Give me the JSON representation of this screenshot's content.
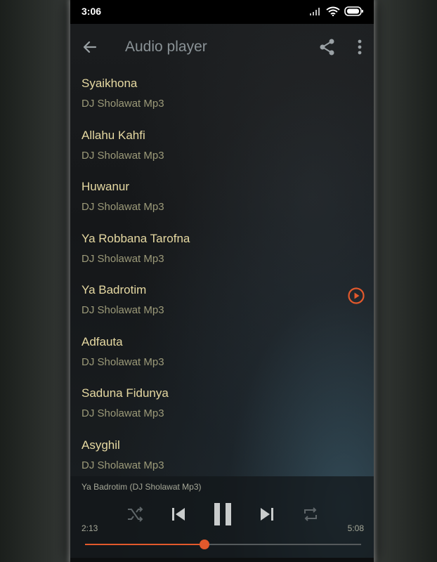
{
  "status_bar": {
    "time": "3:06",
    "icons": [
      "signal-icon",
      "wifi-icon",
      "battery-icon"
    ]
  },
  "app_bar": {
    "title": "Audio player",
    "icons": [
      "back-arrow-icon",
      "share-icon",
      "more-vert-icon"
    ]
  },
  "tracks": [
    {
      "title": "Syaikhona",
      "subtitle": "DJ Sholawat Mp3"
    },
    {
      "title": "Allahu Kahfi",
      "subtitle": "DJ Sholawat Mp3"
    },
    {
      "title": "Huwanur",
      "subtitle": "DJ Sholawat Mp3"
    },
    {
      "title": "Ya Robbana Tarofna",
      "subtitle": "DJ Sholawat Mp3"
    },
    {
      "title": "Ya Badrotim",
      "subtitle": "DJ Sholawat Mp3",
      "playing": true
    },
    {
      "title": "Adfauta",
      "subtitle": "DJ Sholawat Mp3"
    },
    {
      "title": "Saduna Fidunya",
      "subtitle": "DJ Sholawat Mp3"
    },
    {
      "title": "Asyghil",
      "subtitle": "DJ Sholawat Mp3"
    }
  ],
  "player": {
    "now_playing": "Ya Badrotim (DJ Sholawat Mp3)",
    "elapsed": "2:13",
    "total": "5:08",
    "progress_fraction": 0.432,
    "controls": [
      "shuffle-icon",
      "skip-previous-icon",
      "pause-icon",
      "skip-next-icon",
      "repeat-icon"
    ]
  },
  "colors": {
    "accent": "#e2592c",
    "title_text": "#e6d9a2",
    "subtitle_text": "#9c9a79",
    "app_title": "#8a9296"
  }
}
